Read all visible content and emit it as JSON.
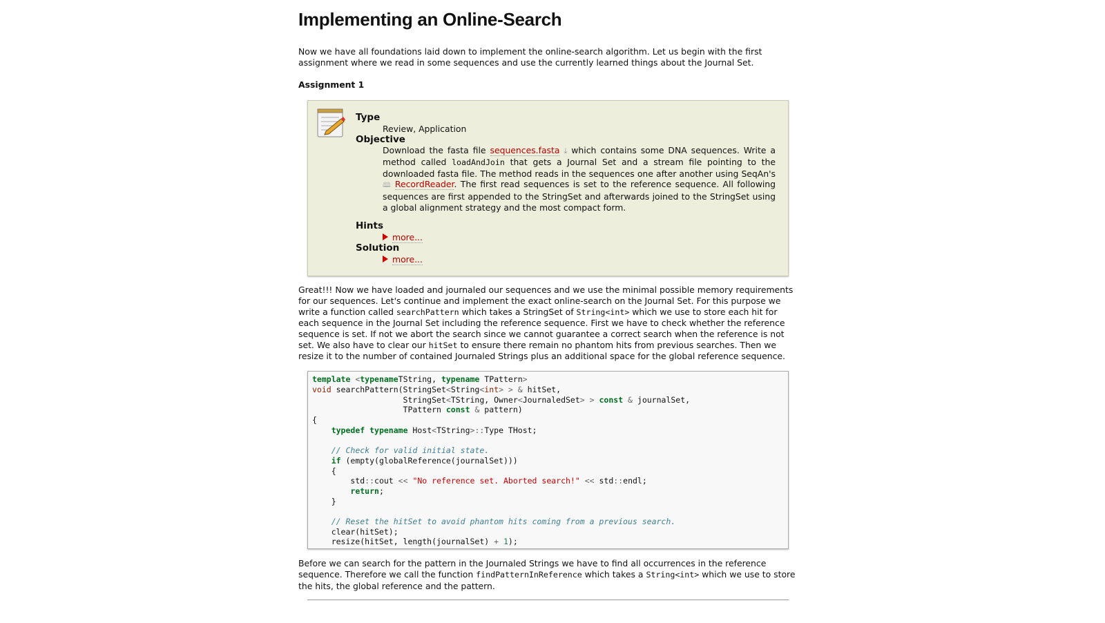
{
  "title": "Implementing an Online-Search",
  "intro": "Now we have all foundations laid down to implement the online-search algorithm. Let us begin with the first assignment where we read in some sequences and use the currently learned things about the Journal Set.",
  "assignment": {
    "heading": "Assignment 1",
    "icon": "notepad-pencil-icon",
    "type_label": "Type",
    "type_value": "Review, Application",
    "objective_label": "Objective",
    "obj": {
      "a": "Download the fasta file ",
      "link1": "sequences.fasta",
      "b": " which contains some DNA sequences. Write a method called ",
      "code1": "loadAndJoin",
      "c": " that gets a Journal Set and a stream file pointing to the downloaded fasta file. The method reads in the sequences one after another using SeqAn's ",
      "link2": "RecordReader",
      "d": ". The first read sequences is set to the reference sequence. All following sequences are first appended to the StringSet and afterwards joined to the StringSet using a global alignment strategy and the most compact form."
    },
    "hints_label": "Hints",
    "hints_more": "more...",
    "solution_label": "Solution",
    "solution_more": "more..."
  },
  "para2": {
    "a": "Great!!! Now we have loaded and journaled our sequences and we use the minimal possible memory requirements for our sequences. Let's continue and implement the exact online-search on the Journal Set. For this purpose we write a function called ",
    "c1": "searchPattern",
    "b": " which takes a StringSet of ",
    "c2": "String<int>",
    "c": " which we use to store each hit for each sequence in the Journal Set including the reference sequence. First we have to check whether the reference sequence is set. If not we abort the search since we cannot guarantee a correct search when the reference is not set. We also have to clear our ",
    "c3": "hitSet",
    "d": " to ensure there remain no phantom hits from previous searches. Then we resize it to the number of contained Journaled Strings plus an additional space for the global reference sequence."
  },
  "code": [
    [
      [
        "k",
        "template"
      ],
      [
        "o",
        " <"
      ],
      [
        "k",
        "typename"
      ],
      [
        "",
        "TString, "
      ],
      [
        "k",
        "typename"
      ],
      [
        "",
        " TPattern"
      ],
      [
        "o",
        ">"
      ]
    ],
    [
      [
        "t",
        "void"
      ],
      [
        "",
        " searchPattern(StringSet"
      ],
      [
        "o",
        "<"
      ],
      [
        "",
        "String"
      ],
      [
        "o",
        "<"
      ],
      [
        "t",
        "int"
      ],
      [
        "o",
        "> >"
      ],
      [
        "o",
        " &"
      ],
      [
        "",
        " hitSet,"
      ]
    ],
    [
      [
        "",
        "                   StringSet"
      ],
      [
        "o",
        "<"
      ],
      [
        "",
        "TString, Owner"
      ],
      [
        "o",
        "<"
      ],
      [
        "",
        "JournaledSet"
      ],
      [
        "o",
        "> >"
      ],
      [
        "",
        " "
      ],
      [
        "k",
        "const"
      ],
      [
        "o",
        " &"
      ],
      [
        "",
        " journalSet,"
      ]
    ],
    [
      [
        "",
        "                   TPattern "
      ],
      [
        "k",
        "const"
      ],
      [
        "o",
        " &"
      ],
      [
        "",
        " pattern)"
      ]
    ],
    [
      [
        "",
        "{"
      ]
    ],
    [
      [
        "",
        "    "
      ],
      [
        "k",
        "typedef"
      ],
      [
        "",
        " "
      ],
      [
        "k",
        "typename"
      ],
      [
        "",
        " Host"
      ],
      [
        "o",
        "<"
      ],
      [
        "",
        "TString"
      ],
      [
        "o",
        ">::"
      ],
      [
        "",
        "Type THost;"
      ]
    ],
    [
      [
        "",
        ""
      ]
    ],
    [
      [
        "",
        "    "
      ],
      [
        "c",
        "// Check for valid initial state."
      ]
    ],
    [
      [
        "",
        "    "
      ],
      [
        "k",
        "if"
      ],
      [
        "",
        " (empty(globalReference(journalSet)))"
      ]
    ],
    [
      [
        "",
        "    {"
      ]
    ],
    [
      [
        "",
        "        std"
      ],
      [
        "o",
        "::"
      ],
      [
        "",
        "cout "
      ],
      [
        "o",
        "<<"
      ],
      [
        "",
        " "
      ],
      [
        "s",
        "\"No reference set. Aborted search!\""
      ],
      [
        "",
        " "
      ],
      [
        "o",
        "<<"
      ],
      [
        "",
        " std"
      ],
      [
        "o",
        "::"
      ],
      [
        "",
        "endl;"
      ]
    ],
    [
      [
        "",
        "        "
      ],
      [
        "k",
        "return"
      ],
      [
        "",
        ";"
      ]
    ],
    [
      [
        "",
        "    }"
      ]
    ],
    [
      [
        "",
        ""
      ]
    ],
    [
      [
        "",
        "    "
      ],
      [
        "c",
        "// Reset the hitSet to avoid phantom hits coming from a previous search."
      ]
    ],
    [
      [
        "",
        "    clear(hitSet);"
      ]
    ],
    [
      [
        "",
        "    resize(hitSet, length(journalSet) "
      ],
      [
        "o",
        "+"
      ],
      [
        "",
        " "
      ],
      [
        "n",
        "1"
      ],
      [
        "",
        ");"
      ]
    ]
  ],
  "para3": {
    "a": "Before we can search for the pattern in the Journaled Strings we have to find all occurrences in the reference sequence. Therefore we call the function ",
    "c1": "findPatternInReference",
    "b": " which takes a ",
    "c2": "String<int>",
    "c": " which we use to store the hits, the global reference and the pattern."
  }
}
